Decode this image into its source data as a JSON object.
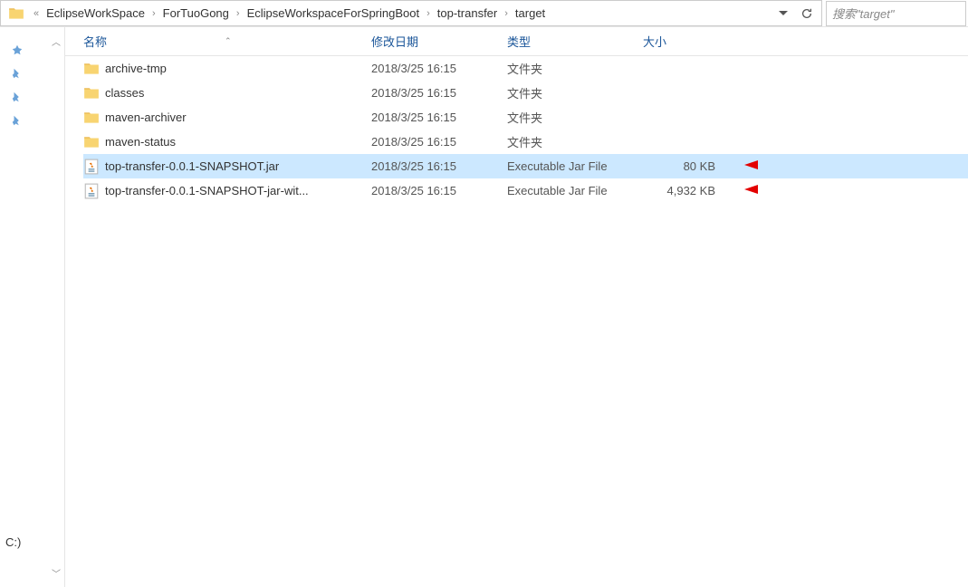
{
  "breadcrumb": {
    "items": [
      "EclipseWorkSpace",
      "ForTuoGong",
      "EclipseWorkspaceForSpringBoot",
      "top-transfer",
      "target"
    ]
  },
  "search": {
    "placeholder": "搜索\"target\""
  },
  "sidebar": {
    "drive": "C:)"
  },
  "columns": {
    "name": "名称",
    "date": "修改日期",
    "type": "类型",
    "size": "大小"
  },
  "files": [
    {
      "icon": "folder",
      "name": "archive-tmp",
      "date": "2018/3/25 16:15",
      "type": "文件夹",
      "size": "",
      "selected": false
    },
    {
      "icon": "folder",
      "name": "classes",
      "date": "2018/3/25 16:15",
      "type": "文件夹",
      "size": "",
      "selected": false
    },
    {
      "icon": "folder",
      "name": "maven-archiver",
      "date": "2018/3/25 16:15",
      "type": "文件夹",
      "size": "",
      "selected": false
    },
    {
      "icon": "folder",
      "name": "maven-status",
      "date": "2018/3/25 16:15",
      "type": "文件夹",
      "size": "",
      "selected": false
    },
    {
      "icon": "jar",
      "name": "top-transfer-0.0.1-SNAPSHOT.jar",
      "date": "2018/3/25 16:15",
      "type": "Executable Jar File",
      "size": "80 KB",
      "selected": true
    },
    {
      "icon": "jar",
      "name": "top-transfer-0.0.1-SNAPSHOT-jar-wit...",
      "date": "2018/3/25 16:15",
      "type": "Executable Jar File",
      "size": "4,932 KB",
      "selected": false
    }
  ]
}
